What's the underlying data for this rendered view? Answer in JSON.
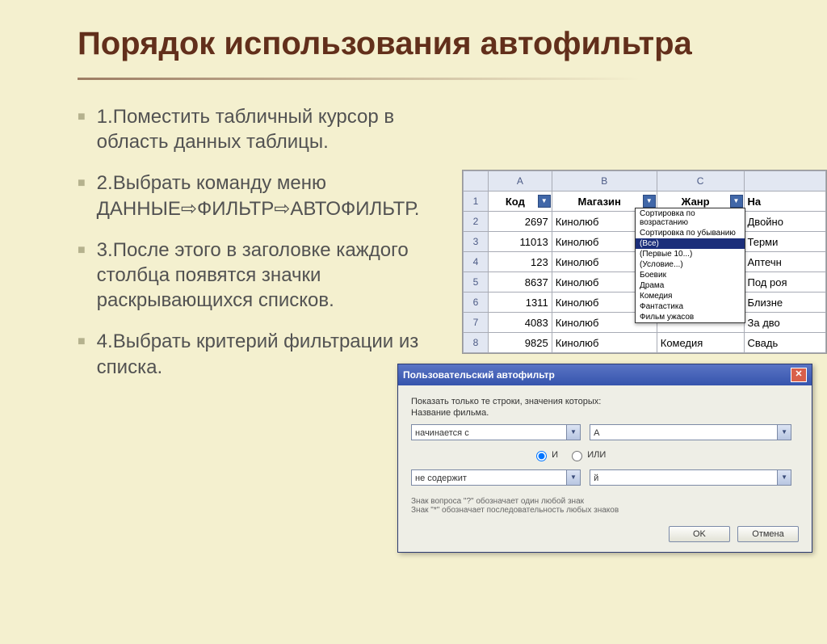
{
  "title": "Порядок использования автофильтра",
  "bullets": [
    "1.Поместить табличный курсор в область данных таблицы.",
    "2.Выбрать команду меню ДАННЫЕ⇨ФИЛЬТР⇨АВТОФИЛЬТР.",
    "3.После этого в заголовке каждого столбца появятся значки раскрывающихся списков.",
    "4.Выбрать критерий фильтрации из списка."
  ],
  "spreadsheet": {
    "colLetters": [
      "A",
      "B",
      "C",
      ""
    ],
    "headers": [
      "Код",
      "Магазин",
      "Жанр",
      "На"
    ],
    "rows": [
      {
        "n": "2",
        "a": "2697",
        "b": "Кинолюб",
        "d": "Двойно"
      },
      {
        "n": "3",
        "a": "11013",
        "b": "Кинолюб",
        "d": "Терми"
      },
      {
        "n": "4",
        "a": "123",
        "b": "Кинолюб",
        "d": "Аптечн"
      },
      {
        "n": "5",
        "a": "8637",
        "b": "Кинолюб",
        "d": "Под роя"
      },
      {
        "n": "6",
        "a": "1311",
        "b": "Кинолюб",
        "d": "Близне"
      },
      {
        "n": "7",
        "a": "4083",
        "b": "Кинолюб",
        "d": "За дво"
      },
      {
        "n": "8",
        "a": "9825",
        "b": "Кинолюб",
        "d": "Свадь"
      }
    ],
    "lastGenre": "Комедия",
    "dropdown": [
      "Сортировка по возрастанию",
      "Сортировка по убыванию",
      "(Все)",
      "(Первые 10...)",
      "(Условие...)",
      "Боевик",
      "Драма",
      "Комедия",
      "Фантастика",
      "Фильм ужасов"
    ],
    "dropdownSelected": "(Все)"
  },
  "dialog": {
    "title": "Пользовательский автофильтр",
    "show_label": "Показать только те строки, значения которых:",
    "field_label": "Название фильма.",
    "cond1": "начинается с",
    "val1": "А",
    "radio_and": "И",
    "radio_or": "ИЛИ",
    "cond2": "не содержит",
    "val2": "й",
    "help1": "Знак вопроса \"?\" обозначает один любой знак",
    "help2": "Знак \"*\" обозначает последовательность любых знаков",
    "ok": "OK",
    "cancel": "Отмена"
  }
}
